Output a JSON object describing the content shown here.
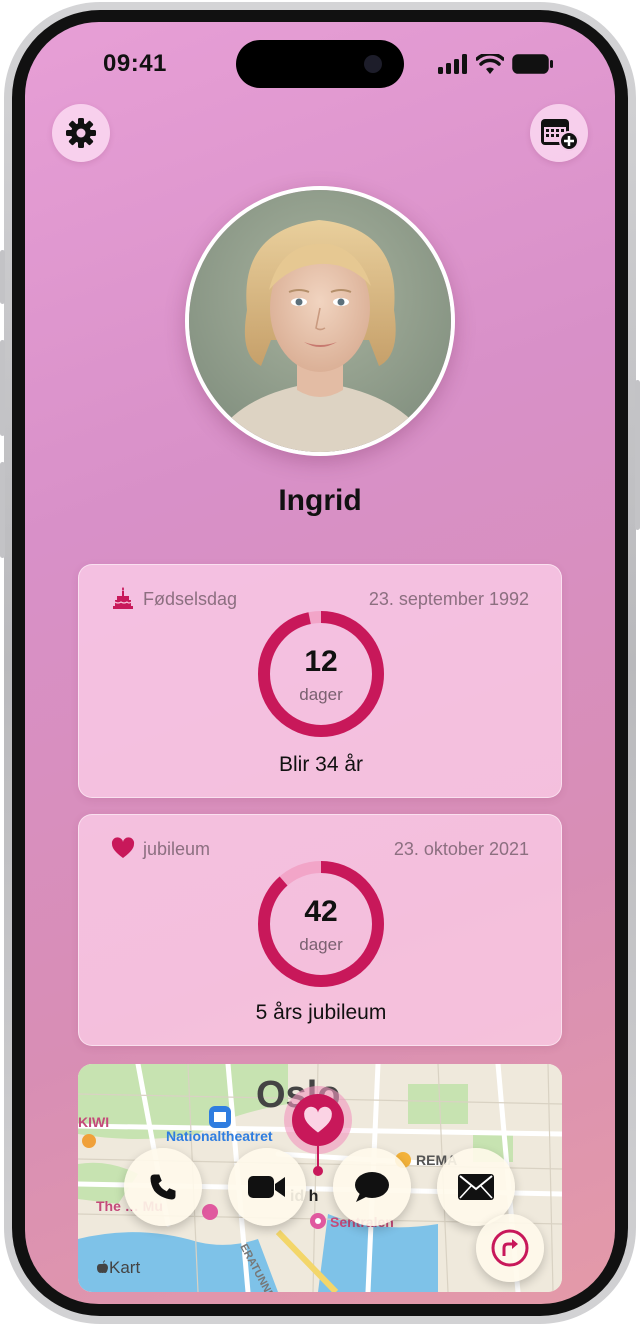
{
  "status_bar": {
    "time": "09:41"
  },
  "header": {
    "settings_icon": "gear-icon",
    "calendar_icon": "calendar-add-icon"
  },
  "profile": {
    "name": "Ingrid"
  },
  "events": [
    {
      "icon": "birthday-cake-icon",
      "label": "Fødselsdag",
      "date": "23. september 1992",
      "count": "12",
      "unit": "dager",
      "subtitle": "Blir 34 år",
      "progress": 0.967
    },
    {
      "icon": "heart-icon",
      "label": "jubileum",
      "date": "23. oktober 2021",
      "count": "42",
      "unit": "dager",
      "subtitle": "5 års jubileum",
      "progress": 0.885
    }
  ],
  "map": {
    "city_label": "Oslo",
    "labels": {
      "nationaltheatret": "Nationaltheatret",
      "kiwi": "KIWI",
      "rema": "REMA",
      "the_mu": "The … Mu",
      "sentralen": "Sentralen",
      "tunnel": "ERATUNNEL",
      "pin_place": "id h",
      "attribution": "Kart"
    },
    "actions": [
      "phone-icon",
      "video-icon",
      "message-icon",
      "mail-icon"
    ],
    "directions_icon": "directions-icon"
  },
  "colors": {
    "accent": "#c8185a",
    "background_top": "#e79fd6",
    "background_bottom": "#e49aa8"
  }
}
